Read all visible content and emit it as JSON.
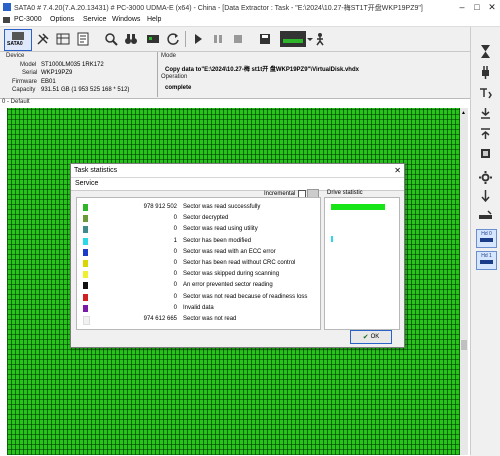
{
  "window": {
    "title": "SATA0 # 7.4.20(7.A.20.13431) # PC-3000 UDMA-E (x64) - China - [Data Extractor : Task - \"E:\\2024\\10.27-梅ST1T开盘WKP19PZ9\"]"
  },
  "menu": {
    "items": [
      "PC-3000",
      "Options",
      "Service",
      "Windows",
      "Help"
    ]
  },
  "toolbar": {
    "port_label": "SATA0"
  },
  "device": {
    "header": "Device",
    "model_label": "Model",
    "model_value": "ST1000LM035 1RK172",
    "serial_label": "Serial",
    "serial_value": "WKP19PZ9",
    "firmware_label": "Firmware",
    "firmware_value": "EB01",
    "capacity_label": "Capacity",
    "capacity_value": "931.51 GB (1 953 525 168 * 512)"
  },
  "mode": {
    "header": "Mode",
    "mode_value": "Copy data to\"E:\\2024\\10.27-梅 st1t开 盘WKP19PZ9\"\\VirtualDisk.vhdx",
    "operation_label": "Operation",
    "operation_value": "complete"
  },
  "grid": {
    "header": "0 - Default"
  },
  "right_panel": {
    "hd0_label": "Hd 0",
    "hd1_label": "Hd 1"
  },
  "dialog": {
    "title": "Task statistics",
    "service": "Service",
    "incremental_label": "Incremental",
    "drive_statistic_label": "Drive statistic",
    "ok_label": "OK",
    "drive_fill_percent": 100,
    "rows": [
      {
        "color": "#2fb52a",
        "count": "978 912 502",
        "desc": "Sector was read successfully"
      },
      {
        "color": "#6a9a3a",
        "count": "0",
        "desc": "Sector decrypted"
      },
      {
        "color": "#3d8b8b",
        "count": "0",
        "desc": "Sector was read using utility"
      },
      {
        "color": "#2ad8e8",
        "count": "1",
        "desc": "Sector has been modified"
      },
      {
        "color": "#1c3bc8",
        "count": "0",
        "desc": "Sector was read with an ECC error"
      },
      {
        "color": "#d8d800",
        "count": "0",
        "desc": "Sector has been read without CRC control"
      },
      {
        "color": "#f0f030",
        "count": "0",
        "desc": "Sector was skipped during scanning"
      },
      {
        "color": "#111111",
        "count": "0",
        "desc": "An error prevented sector reading"
      },
      {
        "color": "#d02020",
        "count": "0",
        "desc": "Sector was not read because of readiness loss"
      },
      {
        "color": "#7a1aa8",
        "count": "0",
        "desc": "Invalid data"
      },
      {
        "color": "#f2f2f2",
        "count": "974 612 665",
        "desc": "Sector was not read"
      }
    ]
  }
}
